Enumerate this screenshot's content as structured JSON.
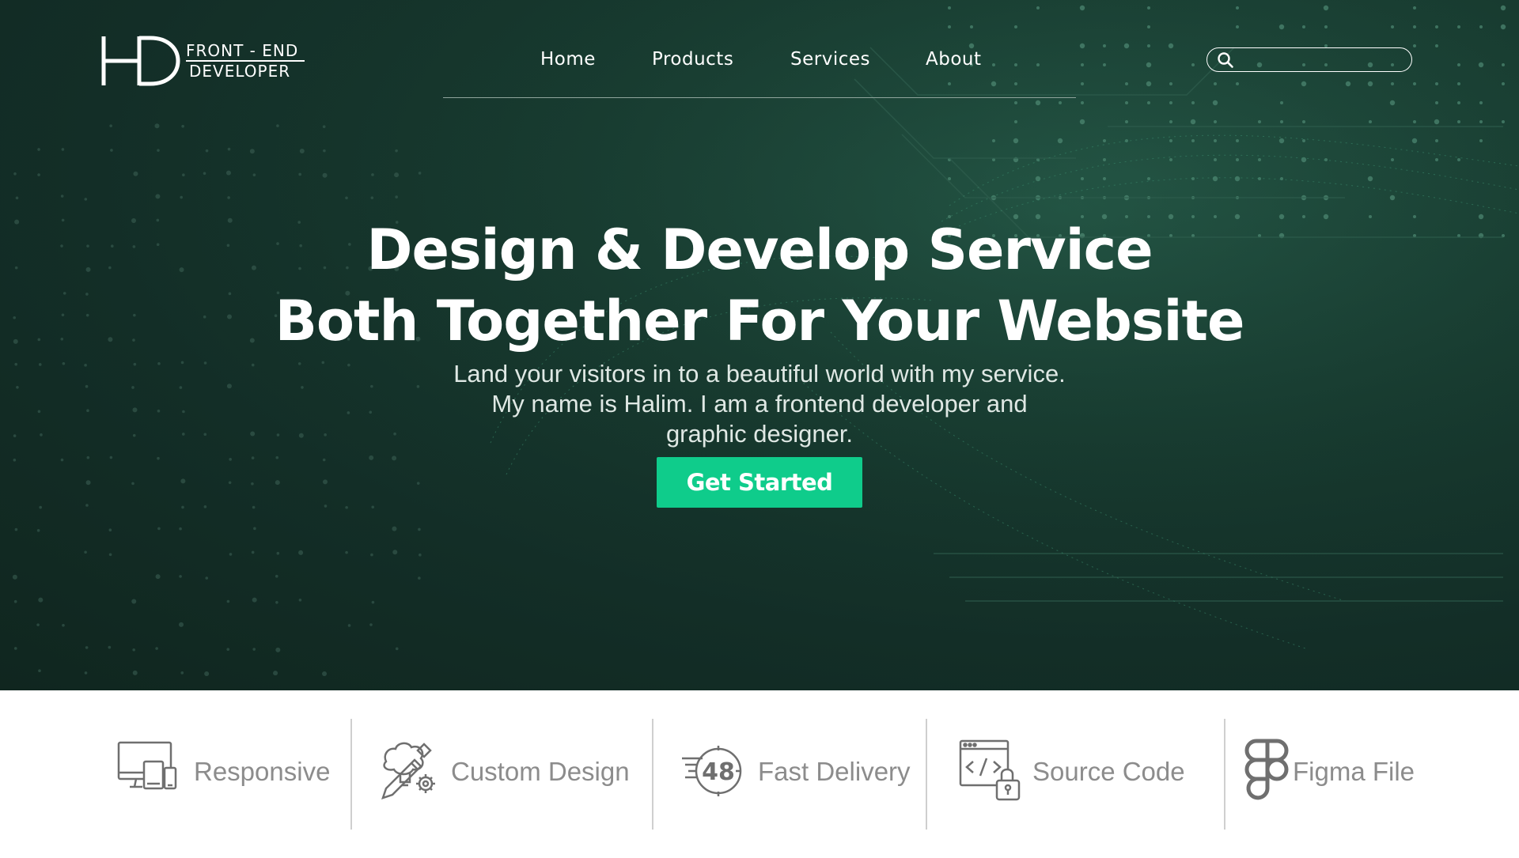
{
  "header": {
    "logo": {
      "mark": "HD",
      "line1": "FRONT - END",
      "line2": "DEVELOPER"
    },
    "nav": [
      {
        "label": "Home"
      },
      {
        "label": "Products"
      },
      {
        "label": "Services"
      },
      {
        "label": "About"
      }
    ],
    "search": {
      "value": "",
      "placeholder": "",
      "icon": "search-icon"
    }
  },
  "hero": {
    "headline_line1": "Design & Develop Service",
    "headline_line2": "Both Together For Your Website",
    "subtitle_line1": "Land your visitors in to a beautiful world with my service.",
    "subtitle_line2": "My name is Halim. I am a frontend developer and",
    "subtitle_line3": "graphic designer.",
    "cta_label": "Get Started"
  },
  "features": [
    {
      "label": "Responsive",
      "icon": "responsive-devices-icon"
    },
    {
      "label": "Custom Design",
      "icon": "custom-design-icon"
    },
    {
      "label": "Fast Delivery",
      "icon": "fast-delivery-icon",
      "badge": "48"
    },
    {
      "label": "Source Code",
      "icon": "source-code-icon"
    },
    {
      "label": "Figma File",
      "icon": "figma-icon"
    }
  ],
  "colors": {
    "hero_background": "#132e27",
    "accent": "#0fcc8b",
    "feature_text": "#8c8c8c",
    "nav_text": "#ffffff"
  }
}
